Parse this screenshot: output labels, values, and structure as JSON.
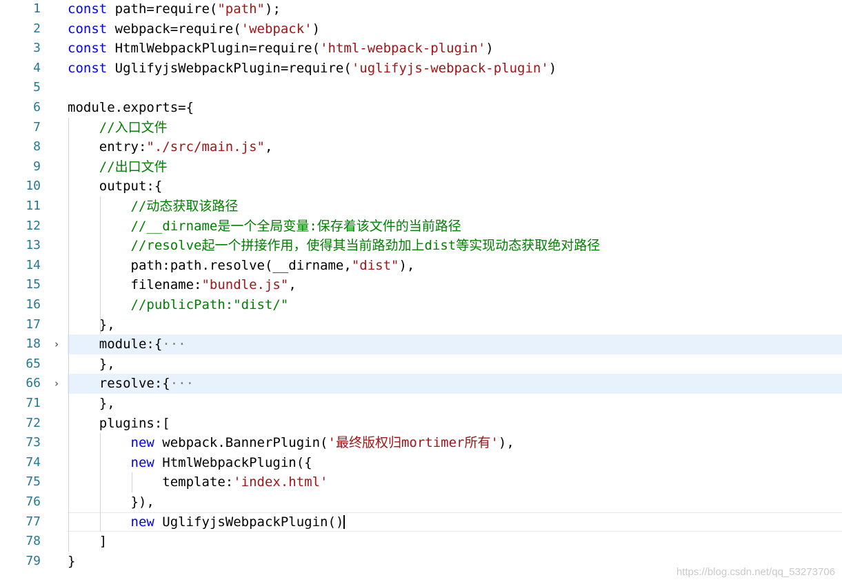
{
  "editor": {
    "lines": [
      {
        "num": "1",
        "tokens": [
          {
            "t": "const",
            "c": "kw"
          },
          {
            "t": " path=require(",
            "c": "p"
          },
          {
            "t": "\"path\"",
            "c": "str"
          },
          {
            "t": ");",
            "c": "p"
          }
        ]
      },
      {
        "num": "2",
        "tokens": [
          {
            "t": "const",
            "c": "kw"
          },
          {
            "t": " webpack=require(",
            "c": "p"
          },
          {
            "t": "'webpack'",
            "c": "str"
          },
          {
            "t": ")",
            "c": "p"
          }
        ]
      },
      {
        "num": "3",
        "tokens": [
          {
            "t": "const",
            "c": "kw"
          },
          {
            "t": " HtmlWebpackPlugin=require(",
            "c": "p"
          },
          {
            "t": "'html-webpack-plugin'",
            "c": "str"
          },
          {
            "t": ")",
            "c": "p"
          }
        ]
      },
      {
        "num": "4",
        "tokens": [
          {
            "t": "const",
            "c": "kw"
          },
          {
            "t": " UglifyjsWebpackPlugin=require(",
            "c": "p"
          },
          {
            "t": "'uglifyjs-webpack-plugin'",
            "c": "str"
          },
          {
            "t": ")",
            "c": "p"
          }
        ]
      },
      {
        "num": "5",
        "tokens": []
      },
      {
        "num": "6",
        "tokens": [
          {
            "t": "module.exports={",
            "c": "p"
          }
        ]
      },
      {
        "num": "7",
        "tokens": [
          {
            "t": "    ",
            "c": "p"
          },
          {
            "t": "//入口文件",
            "c": "com"
          }
        ]
      },
      {
        "num": "8",
        "tokens": [
          {
            "t": "    entry:",
            "c": "p"
          },
          {
            "t": "\"./src/main.js\"",
            "c": "str"
          },
          {
            "t": ",",
            "c": "p"
          }
        ]
      },
      {
        "num": "9",
        "tokens": [
          {
            "t": "    ",
            "c": "p"
          },
          {
            "t": "//出口文件",
            "c": "com"
          }
        ]
      },
      {
        "num": "10",
        "tokens": [
          {
            "t": "    output:{",
            "c": "p"
          }
        ]
      },
      {
        "num": "11",
        "tokens": [
          {
            "t": "        ",
            "c": "p"
          },
          {
            "t": "//动态获取该路径",
            "c": "com"
          }
        ]
      },
      {
        "num": "12",
        "tokens": [
          {
            "t": "        ",
            "c": "p"
          },
          {
            "t": "//__dirname是一个全局变量:保存着该文件的当前路径",
            "c": "com"
          }
        ]
      },
      {
        "num": "13",
        "tokens": [
          {
            "t": "        ",
            "c": "p"
          },
          {
            "t": "//resolve起一个拼接作用，使得其当前路劲加上dist等实现动态获取绝对路径",
            "c": "com"
          }
        ]
      },
      {
        "num": "14",
        "tokens": [
          {
            "t": "        path:path.resolve(__dirname,",
            "c": "p"
          },
          {
            "t": "\"dist\"",
            "c": "str"
          },
          {
            "t": "),",
            "c": "p"
          }
        ]
      },
      {
        "num": "15",
        "tokens": [
          {
            "t": "        filename:",
            "c": "p"
          },
          {
            "t": "\"bundle.js\"",
            "c": "str"
          },
          {
            "t": ",",
            "c": "p"
          }
        ]
      },
      {
        "num": "16",
        "tokens": [
          {
            "t": "        ",
            "c": "p"
          },
          {
            "t": "//publicPath:\"dist/\"",
            "c": "com"
          }
        ]
      },
      {
        "num": "17",
        "tokens": [
          {
            "t": "    },",
            "c": "p"
          }
        ]
      },
      {
        "num": "18",
        "fold": "›",
        "folded": true,
        "tokens": [
          {
            "t": "    module:{",
            "c": "p"
          },
          {
            "t": "···",
            "c": "ell"
          }
        ]
      },
      {
        "num": "65",
        "tokens": [
          {
            "t": "    },",
            "c": "p"
          }
        ]
      },
      {
        "num": "66",
        "fold": "›",
        "folded": true,
        "tokens": [
          {
            "t": "    resolve:{",
            "c": "p"
          },
          {
            "t": "···",
            "c": "ell"
          }
        ]
      },
      {
        "num": "71",
        "tokens": [
          {
            "t": "    },",
            "c": "p"
          }
        ]
      },
      {
        "num": "72",
        "tokens": [
          {
            "t": "    plugins:[",
            "c": "p"
          }
        ]
      },
      {
        "num": "73",
        "tokens": [
          {
            "t": "        ",
            "c": "p"
          },
          {
            "t": "new",
            "c": "kw"
          },
          {
            "t": " webpack.BannerPlugin(",
            "c": "p"
          },
          {
            "t": "'最终版权归mortimer所有'",
            "c": "str"
          },
          {
            "t": "),",
            "c": "p"
          }
        ]
      },
      {
        "num": "74",
        "tokens": [
          {
            "t": "        ",
            "c": "p"
          },
          {
            "t": "new",
            "c": "kw"
          },
          {
            "t": " HtmlWebpackPlugin({",
            "c": "p"
          }
        ]
      },
      {
        "num": "75",
        "tokens": [
          {
            "t": "            template:",
            "c": "p"
          },
          {
            "t": "'index.html'",
            "c": "str"
          }
        ]
      },
      {
        "num": "76",
        "tokens": [
          {
            "t": "        }),",
            "c": "p"
          }
        ]
      },
      {
        "num": "77",
        "current": true,
        "tokens": [
          {
            "t": "        ",
            "c": "p"
          },
          {
            "t": "new",
            "c": "kw"
          },
          {
            "t": " UglifyjsWebpackPlugin()",
            "c": "p"
          }
        ]
      },
      {
        "num": "78",
        "tokens": [
          {
            "t": "    ]",
            "c": "p"
          }
        ]
      },
      {
        "num": "79",
        "tokens": [
          {
            "t": "}",
            "c": "p"
          }
        ]
      }
    ]
  },
  "watermark": "https://blog.csdn.net/qq_53273706",
  "colors": {
    "keyword": "#0000ff",
    "string": "#a31515",
    "comment": "#008000",
    "line_number": "#237893",
    "fold_highlight": "#e8f2fc"
  }
}
